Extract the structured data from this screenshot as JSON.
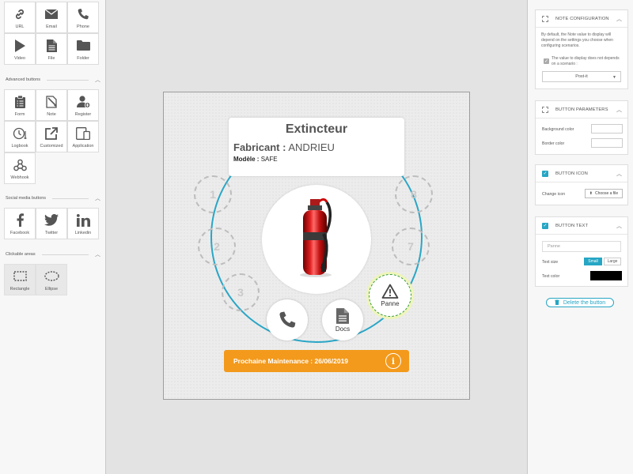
{
  "left_panel": {
    "basic_buttons": [
      {
        "label": "URL",
        "icon": "link-icon"
      },
      {
        "label": "Email",
        "icon": "envelope-icon"
      },
      {
        "label": "Phone",
        "icon": "phone-icon"
      },
      {
        "label": "Video",
        "icon": "play-icon"
      },
      {
        "label": "File",
        "icon": "file-icon"
      },
      {
        "label": "Folder",
        "icon": "folder-icon"
      }
    ],
    "advanced_header": "Advanced buttons",
    "advanced_buttons": [
      {
        "label": "Form",
        "icon": "clipboard-icon"
      },
      {
        "label": "Note",
        "icon": "note-icon"
      },
      {
        "label": "Register",
        "icon": "user-add-icon"
      },
      {
        "label": "Logbook",
        "icon": "clock-list-icon"
      },
      {
        "label": "Customized",
        "icon": "external-icon"
      },
      {
        "label": "Application",
        "icon": "devices-icon"
      },
      {
        "label": "Webhook",
        "icon": "webhook-icon"
      }
    ],
    "social_header": "Social media buttons",
    "social_buttons": [
      {
        "label": "Facebook",
        "icon": "facebook-icon"
      },
      {
        "label": "Twitter",
        "icon": "twitter-icon"
      },
      {
        "label": "Linkedin",
        "icon": "linkedin-icon"
      }
    ],
    "clickable_header": "Clickable areas",
    "clickable_areas": [
      {
        "label": "Rectangle",
        "icon": "rectangle-dashed-icon"
      },
      {
        "label": "Ellipse",
        "icon": "ellipse-dashed-icon"
      }
    ]
  },
  "canvas": {
    "card": {
      "title": "Extincteur",
      "fabricant_label": "Fabricant :",
      "fabricant_value": "ANDRIEU",
      "modele_label": "Modèle :",
      "modele_value": "SAFE"
    },
    "placeholders": [
      "1",
      "2",
      "3",
      "8",
      "7"
    ],
    "buttons": {
      "phone_icon": "phone-icon",
      "docs_label": "Docs",
      "panne_label": "Panne"
    },
    "maintenance_text": "Prochaine Maintenance : 26/06/2019",
    "ring_color": "#2aa6c6",
    "maintenance_color": "#f39a1c"
  },
  "right_panel": {
    "note_config": {
      "title": "NOTE CONFIGURATION",
      "description": "By default, the Note value to display will depend on the settings you choose when configuring scenarios.",
      "checkbox_label": "The value to display does not depends on a scenario :",
      "select_value": "Post-it"
    },
    "button_params": {
      "title": "BUTTON PARAMETERS",
      "background_label": "Background color",
      "border_label": "Border color"
    },
    "button_icon": {
      "title": "BUTTON ICON",
      "change_label": "Change icon",
      "choose_label": "Choose a file"
    },
    "button_text": {
      "title": "BUTTON TEXT",
      "input_value": "Panne",
      "size_label": "Text size",
      "size_small": "Small",
      "size_large": "Large",
      "color_label": "Text color",
      "text_color": "#000000"
    },
    "delete_label": "Delete the button",
    "accent_color": "#26a6c4"
  }
}
